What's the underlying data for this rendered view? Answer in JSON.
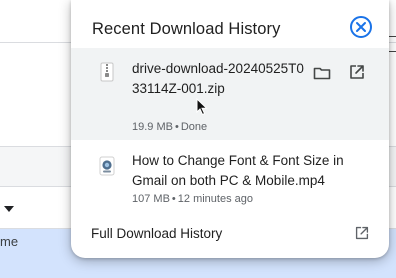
{
  "background": {
    "partial_text": "me"
  },
  "popup": {
    "title": "Recent Download History",
    "accent_color": "#1a73e8",
    "close_icon": "close-circle-icon",
    "items": [
      {
        "name": "drive-download-20240525T033114Z-001.zip",
        "size": "19.9 MB",
        "separator": "•",
        "status": "Done",
        "file_icon": "zip-file-icon",
        "actions": [
          "folder-icon",
          "open-external-icon"
        ]
      },
      {
        "name": "How to Change Font & Font Size in Gmail on both PC & Mobile.mp4",
        "size": "107 MB",
        "separator": "•",
        "status": "12 minutes ago",
        "file_icon": "video-file-icon"
      }
    ],
    "footer": {
      "label": "Full Download History",
      "icon": "open-external-icon"
    }
  }
}
